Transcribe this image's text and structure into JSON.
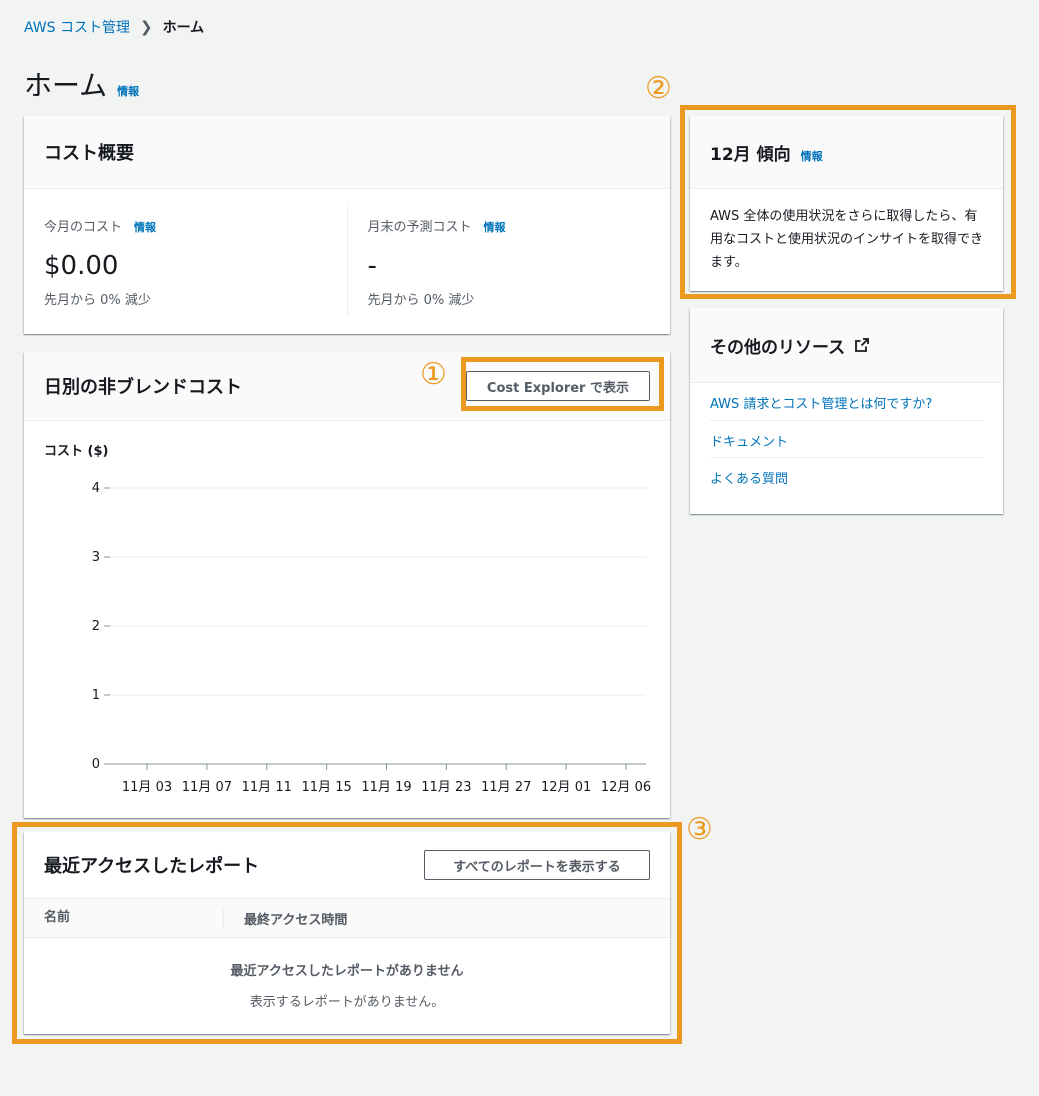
{
  "breadcrumb": {
    "root": "AWS コスト管理",
    "current": "ホーム"
  },
  "page": {
    "title": "ホーム",
    "info": "情報"
  },
  "cost_summary": {
    "title": "コスト概要",
    "this_month": {
      "label": "今月のコスト",
      "info": "情報",
      "value": "$0.00",
      "sub": "先月から 0% 減少"
    },
    "forecast": {
      "label": "月末の予測コスト",
      "info": "情報",
      "value": "-",
      "sub": "先月から 0% 減少"
    }
  },
  "daily": {
    "title": "日別の非ブレンドコスト",
    "button": "Cost Explorer で表示",
    "ylabel": "コスト ($)"
  },
  "chart_data": {
    "type": "line",
    "categories": [
      "11月 03",
      "11月 07",
      "11月 11",
      "11月 15",
      "11月 19",
      "11月 23",
      "11月 27",
      "12月 01",
      "12月 06"
    ],
    "yticks": [
      0,
      1,
      2,
      3,
      4
    ],
    "ylim": [
      0,
      4
    ],
    "ylabel": "コスト ($)",
    "series": [],
    "grid": true
  },
  "trend": {
    "title": "12月 傾向",
    "info": "情報",
    "body": "AWS 全体の使用状況をさらに取得したら、有用なコストと使用状況のインサイトを取得できます。"
  },
  "resources": {
    "title": "その他のリソース",
    "items": [
      "AWS 請求とコスト管理とは何ですか?",
      "ドキュメント",
      "よくある質問"
    ]
  },
  "reports": {
    "title": "最近アクセスしたレポート",
    "button": "すべてのレポートを表示する",
    "col_name": "名前",
    "col_access": "最終アクセス時間",
    "empty_title": "最近アクセスしたレポートがありません",
    "empty_desc": "表示するレポートがありません。"
  },
  "annotations": {
    "n1": "①",
    "n2": "②",
    "n3": "③"
  },
  "colors": {
    "highlight": "#ec9a1f",
    "link": "#0073bb"
  }
}
